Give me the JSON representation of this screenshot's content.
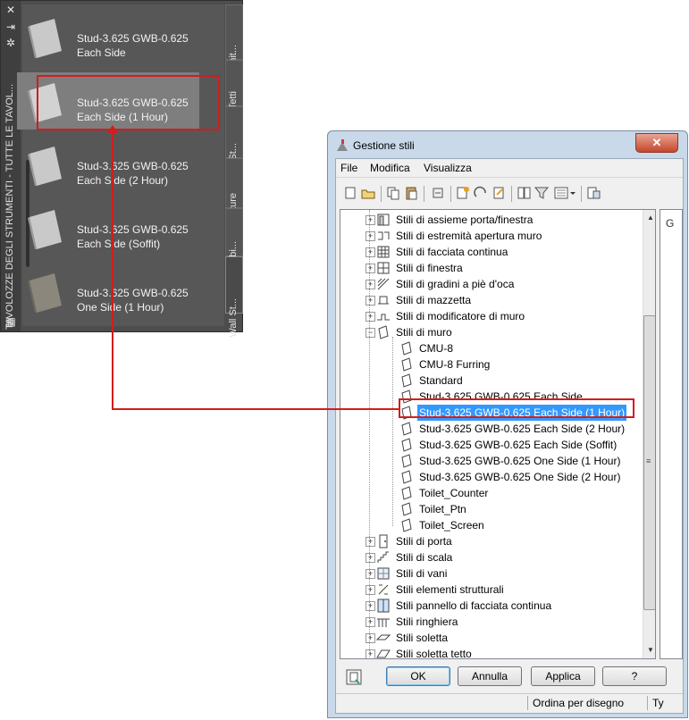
{
  "palette": {
    "title": "TAVOLOZZE DEGLI STRUMENTI - TUTTE LE TAVOL...",
    "tools": [
      {
        "label_line1": "Stud-3.625 GWB-0.625",
        "label_line2": "Each Side"
      },
      {
        "label_line1": "Stud-3.625 GWB-0.625",
        "label_line2": "Each Side (1 Hour)"
      },
      {
        "label_line1": "Stud-3.625 GWB-0.625",
        "label_line2": "Each Side (2 Hour)"
      },
      {
        "label_line1": "Stud-3.625 GWB-0.625",
        "label_line2": "Each Side (Soffit)"
      },
      {
        "label_line1": "Stud-3.625 GWB-0.625",
        "label_line2": "One Side (1 Hour)"
      }
    ],
    "tabs": [
      "D_Finit...",
      "D_Tetti",
      "Door St...",
      "Furniture",
      "Plumbi...",
      "Wall St..."
    ]
  },
  "dialog": {
    "title": "Gestione stili",
    "close_label": "✕",
    "menu": [
      "File",
      "Modifica",
      "Visualizza"
    ],
    "tree": [
      {
        "label": "Stili di assieme porta/finestra",
        "icon": "door-window-assembly-icon"
      },
      {
        "label": "Stili di estremità apertura muro",
        "icon": "wall-opening-endcap-icon"
      },
      {
        "label": "Stili di facciata continua",
        "icon": "curtain-wall-icon"
      },
      {
        "label": "Stili di finestra",
        "icon": "window-icon"
      },
      {
        "label": "Stili di gradini a piè d'oca",
        "icon": "winder-icon"
      },
      {
        "label": "Stili di mazzetta",
        "icon": "jamb-icon"
      },
      {
        "label": "Stili di modificatore di muro",
        "icon": "wall-modifier-icon"
      },
      {
        "label": "Stili di muro",
        "icon": "wall-style-icon",
        "expanded": true
      },
      {
        "label": "CMU-8",
        "icon": "style-item-icon",
        "child": true
      },
      {
        "label": "CMU-8 Furring",
        "icon": "style-item-icon",
        "child": true
      },
      {
        "label": "Standard",
        "icon": "style-item-icon",
        "child": true
      },
      {
        "label": "Stud-3.625 GWB-0.625 Each Side",
        "icon": "style-item-icon",
        "child": true
      },
      {
        "label": "Stud-3.625 GWB-0.625 Each Side (1 Hour)",
        "icon": "style-item-icon",
        "child": true,
        "selected": true
      },
      {
        "label": "Stud-3.625 GWB-0.625 Each Side (2 Hour)",
        "icon": "style-item-icon",
        "child": true
      },
      {
        "label": "Stud-3.625 GWB-0.625 Each Side (Soffit)",
        "icon": "style-item-icon",
        "child": true
      },
      {
        "label": "Stud-3.625 GWB-0.625 One Side (1 Hour)",
        "icon": "style-item-icon",
        "child": true
      },
      {
        "label": "Stud-3.625 GWB-0.625 One Side (2 Hour)",
        "icon": "style-item-icon",
        "child": true
      },
      {
        "label": "Toilet_Counter",
        "icon": "style-item-icon",
        "child": true
      },
      {
        "label": "Toilet_Ptn",
        "icon": "style-item-icon",
        "child": true
      },
      {
        "label": "Toilet_Screen",
        "icon": "style-item-icon",
        "child": true
      },
      {
        "label": "Stili di porta",
        "icon": "door-icon"
      },
      {
        "label": "Stili di scala",
        "icon": "stair-icon"
      },
      {
        "label": "Stili di vani",
        "icon": "space-icon"
      },
      {
        "label": "Stili elementi strutturali",
        "icon": "structural-member-icon"
      },
      {
        "label": "Stili pannello di facciata continua",
        "icon": "curtain-wall-unit-icon"
      },
      {
        "label": "Stili ringhiera",
        "icon": "railing-icon"
      },
      {
        "label": "Stili soletta",
        "icon": "slab-icon"
      },
      {
        "label": "Stili soletta tetto",
        "icon": "roof-slab-icon"
      }
    ],
    "right_pane_label": "G",
    "buttons": {
      "ok": "OK",
      "cancel": "Annulla",
      "apply": "Applica",
      "help": "?"
    },
    "status": {
      "sort": "Ordina per disegno",
      "type": "Ty"
    }
  },
  "colors": {
    "highlight": "#3399ff",
    "callout": "#d21d1d"
  }
}
